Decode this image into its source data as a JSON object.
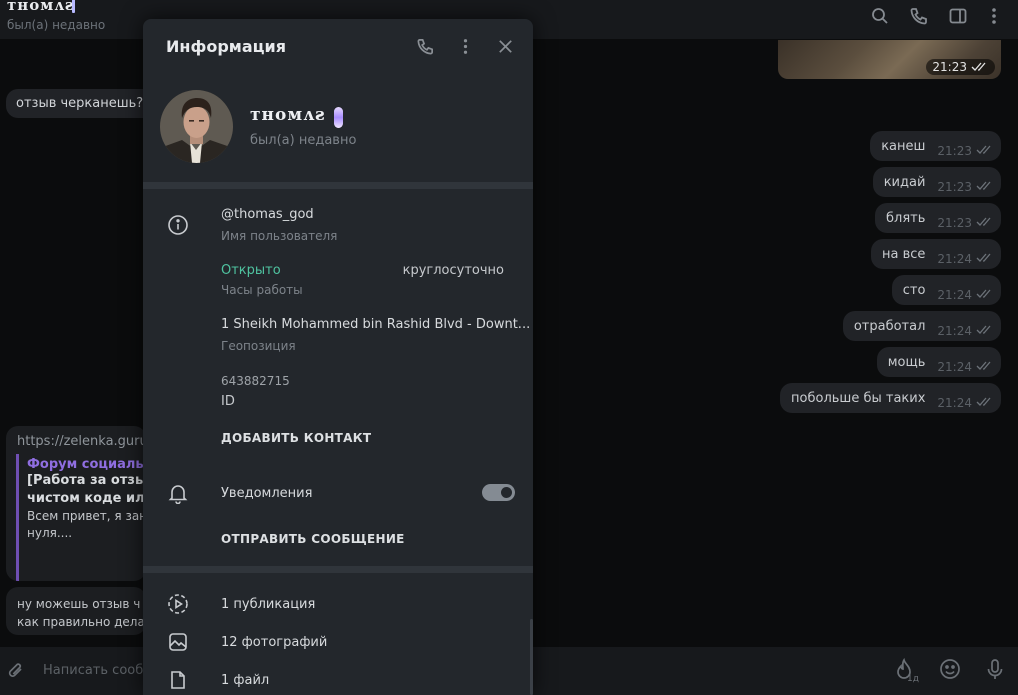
{
  "chat_header": {
    "title": "ᴛʜᴏᴍᴧƨ",
    "status": "был(а) недавно",
    "icons": [
      "search-icon",
      "phone-icon",
      "sidebar-icon",
      "more-vertical-icon"
    ]
  },
  "messages": {
    "image_time": "21:23",
    "incoming_top": "отзыв черканешь?)",
    "outgoing": [
      {
        "text": "канеш",
        "time": "21:23"
      },
      {
        "text": "кидай",
        "time": "21:23"
      },
      {
        "text": "блять",
        "time": "21:23"
      },
      {
        "text": "на все",
        "time": "21:24"
      },
      {
        "text": "сто",
        "time": "21:24"
      },
      {
        "text": "отработал",
        "time": "21:24"
      },
      {
        "text": "мощь",
        "time": "21:24"
      },
      {
        "text": "побольше бы таких",
        "time": "21:24"
      }
    ],
    "link_card": {
      "url": "https://zelenka.guru/",
      "title": "Форум социальн",
      "head1": "[Работа за отзыв",
      "head2": "чистом коде или ",
      "body1": "Всем привет, я зан",
      "body2": "нуля...."
    },
    "bottom": {
      "line1": "ну можешь отзыв ч",
      "line2": "как правильно дела"
    }
  },
  "composer": {
    "placeholder": "Написать сообщение...",
    "badge": "1д",
    "icons": [
      "paperclip-icon",
      "fire-icon",
      "emoji-icon",
      "microphone-icon"
    ]
  },
  "info_panel": {
    "title": "Информация",
    "icons": [
      "phone-icon",
      "more-vertical-icon",
      "close-icon"
    ],
    "name": "ᴛʜᴏᴍᴧƨ",
    "status": "был(а) недавно",
    "username": "@thomas_god",
    "username_label": "Имя пользователя",
    "hours_status": "Открыто",
    "hours_value": "круглосуточно",
    "hours_label": "Часы работы",
    "location": "1 Sheikh Mohammed bin Rashid Blvd - Downt...",
    "location_label": "Геопозиция",
    "id_value": "643882715",
    "id_label": "ID",
    "add_contact": "ДОБАВИТЬ КОНТАКТ",
    "notifications": "Уведомления",
    "notifications_on": true,
    "send_message": "ОТПРАВИТЬ СООБЩЕНИЕ",
    "media": [
      {
        "icon": "story-icon",
        "label": "1 публикация"
      },
      {
        "icon": "photo-icon",
        "label": "12 фотографий"
      },
      {
        "icon": "file-icon",
        "label": "1 файл"
      }
    ],
    "colors": {
      "accent_green": "#4fc3a0",
      "panel_bg": "#23272c",
      "link_purple": "#8f6ee0"
    }
  }
}
